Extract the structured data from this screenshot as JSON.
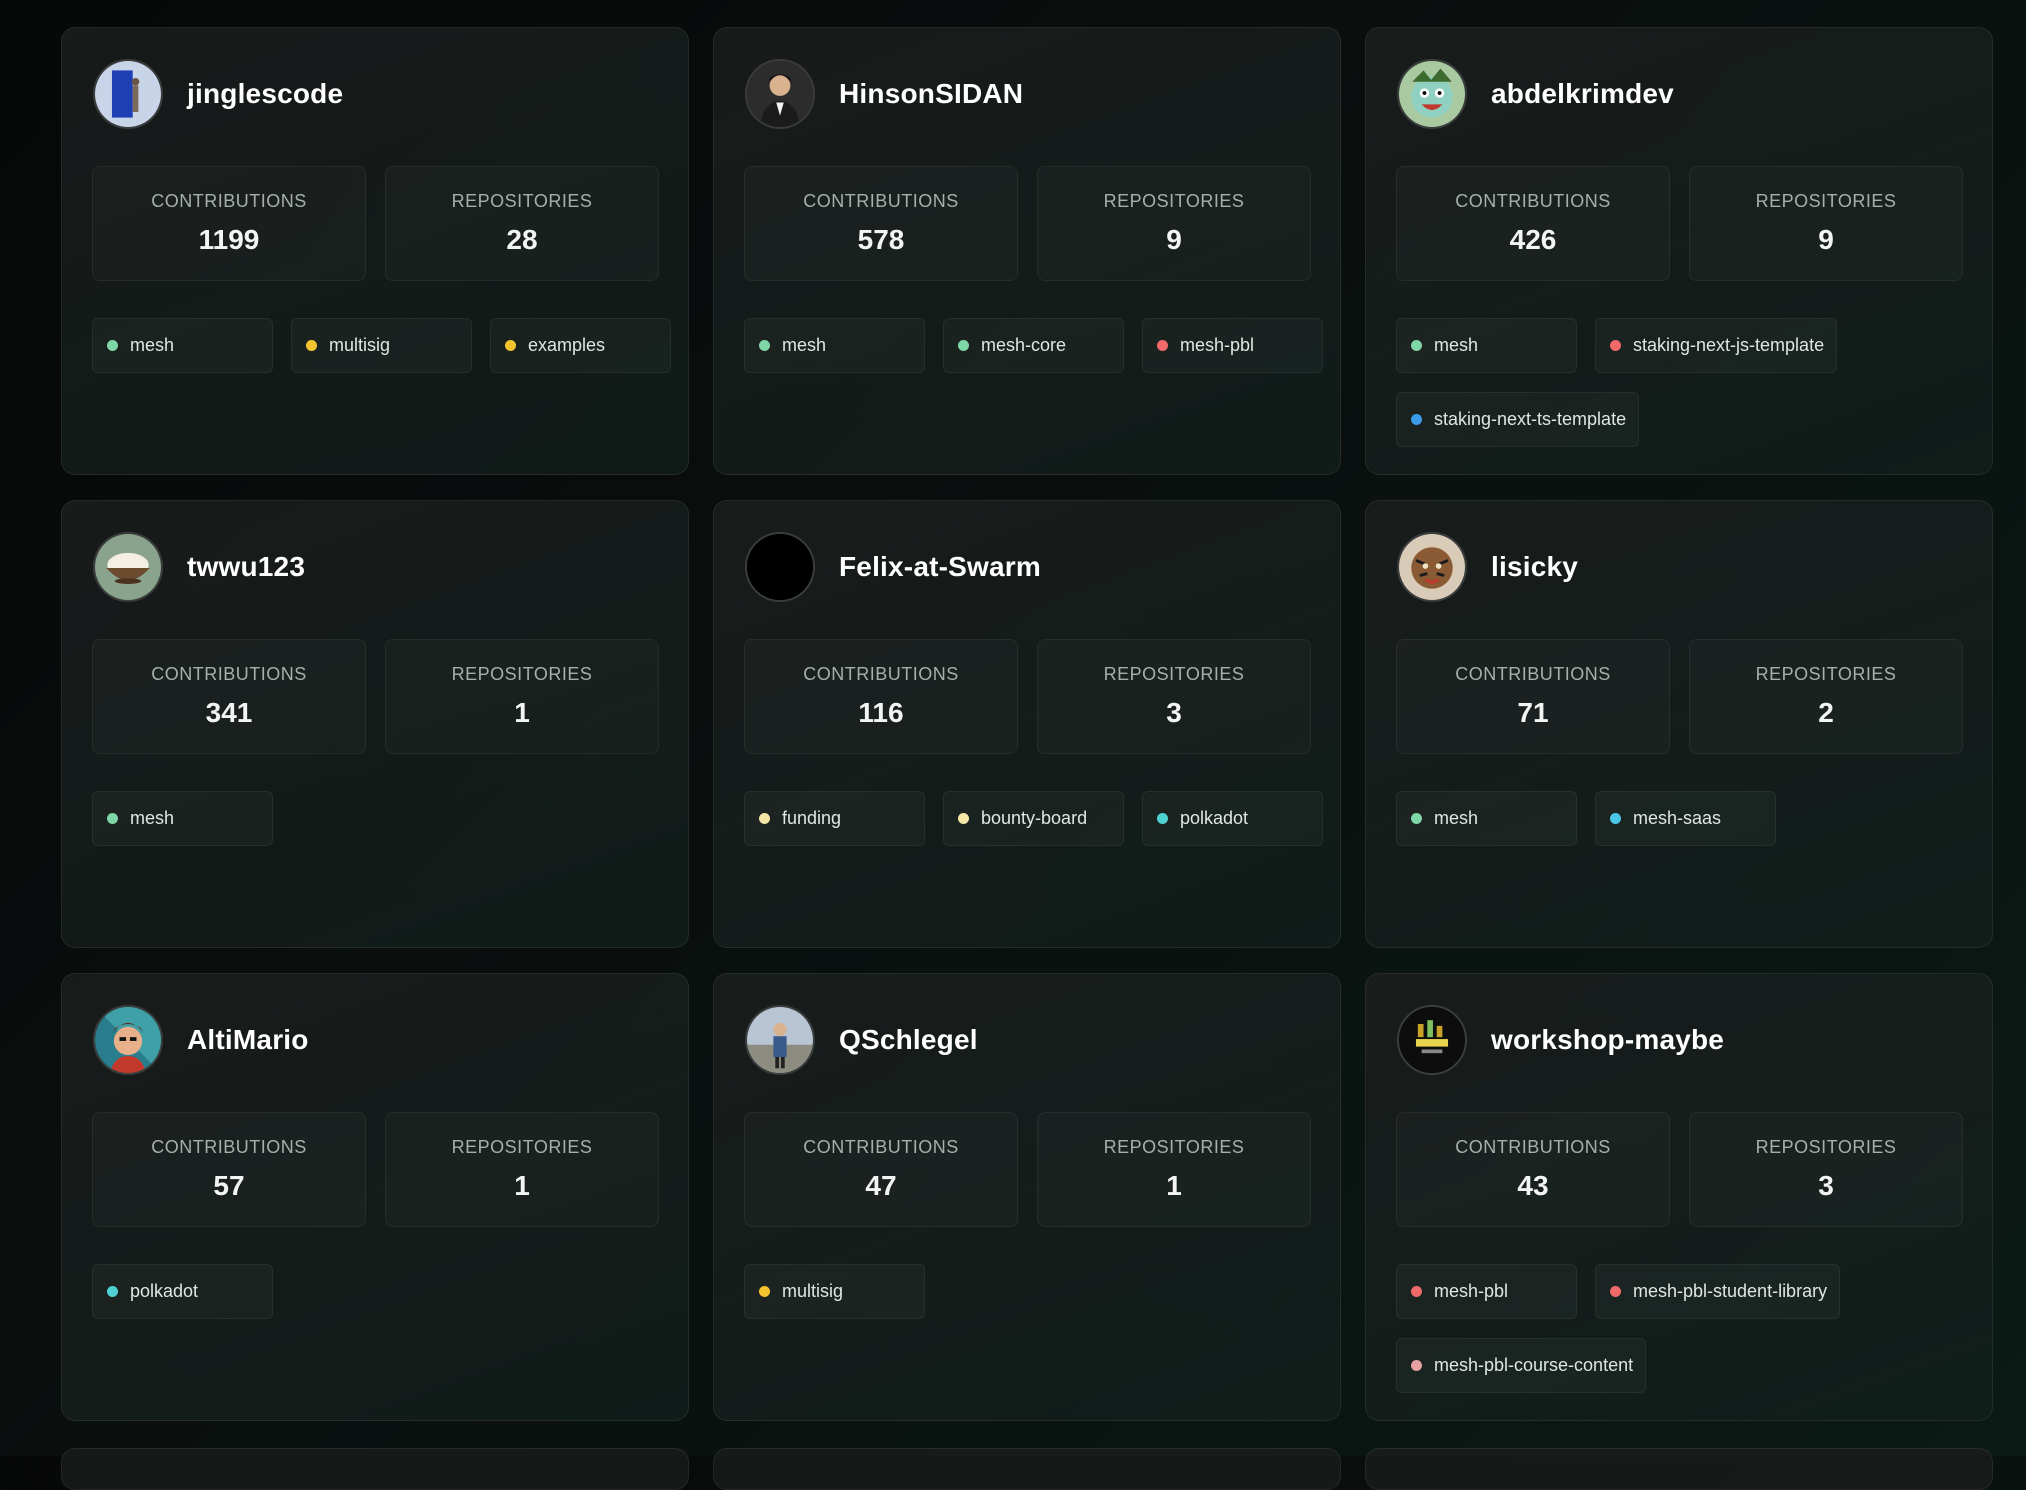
{
  "labels": {
    "contributions": "CONTRIBUTIONS",
    "repositories": "REPOSITORIES"
  },
  "colors": {
    "green": "#7fd6a6",
    "yellow": "#f4c430",
    "red": "#f06a6a",
    "blue": "#3b9be8",
    "teal": "#4fd1d1",
    "cream": "#f5e6a8",
    "cyan": "#4cc6e6",
    "pink": "#e8a0a0"
  },
  "contributors": [
    {
      "username": "jinglescode",
      "avatar": "avatar-blue-door",
      "contributions": "1199",
      "repositories": "28",
      "repos": [
        {
          "name": "mesh",
          "color": "#7fd6a6"
        },
        {
          "name": "multisig",
          "color": "#f4c430"
        },
        {
          "name": "examples",
          "color": "#f4c430"
        }
      ]
    },
    {
      "username": "HinsonSIDAN",
      "avatar": "avatar-portrait-man",
      "contributions": "578",
      "repositories": "9",
      "repos": [
        {
          "name": "mesh",
          "color": "#7fd6a6"
        },
        {
          "name": "mesh-core",
          "color": "#7fd6a6"
        },
        {
          "name": "mesh-pbl",
          "color": "#f06a6a"
        }
      ]
    },
    {
      "username": "abdelkrimdev",
      "avatar": "avatar-cartoon-face",
      "contributions": "426",
      "repositories": "9",
      "repos": [
        {
          "name": "mesh",
          "color": "#7fd6a6"
        },
        {
          "name": "staking-next-js-template",
          "color": "#f06a6a"
        },
        {
          "name": "staking-next-ts-template",
          "color": "#3b9be8"
        }
      ]
    },
    {
      "username": "twwu123",
      "avatar": "avatar-rice-bowl",
      "contributions": "341",
      "repositories": "1",
      "repos": [
        {
          "name": "mesh",
          "color": "#7fd6a6"
        }
      ]
    },
    {
      "username": "Felix-at-Swarm",
      "avatar": "avatar-black",
      "contributions": "116",
      "repositories": "3",
      "repos": [
        {
          "name": "funding",
          "color": "#f5e6a8"
        },
        {
          "name": "bounty-board",
          "color": "#f5e6a8"
        },
        {
          "name": "polkadot",
          "color": "#4fd1d1"
        }
      ]
    },
    {
      "username": "lisicky",
      "avatar": "avatar-tiger",
      "contributions": "71",
      "repositories": "2",
      "repos": [
        {
          "name": "mesh",
          "color": "#7fd6a6"
        },
        {
          "name": "mesh-saas",
          "color": "#4cc6e6"
        }
      ]
    },
    {
      "username": "AltiMario",
      "avatar": "avatar-cartoon-man",
      "contributions": "57",
      "repositories": "1",
      "repos": [
        {
          "name": "polkadot",
          "color": "#4fd1d1"
        }
      ]
    },
    {
      "username": "QSchlegel",
      "avatar": "avatar-person-outdoor",
      "contributions": "47",
      "repositories": "1",
      "repos": [
        {
          "name": "multisig",
          "color": "#f4c430"
        }
      ]
    },
    {
      "username": "workshop-maybe",
      "avatar": "avatar-workshop-logo",
      "contributions": "43",
      "repositories": "3",
      "repos": [
        {
          "name": "mesh-pbl",
          "color": "#f06a6a"
        },
        {
          "name": "mesh-pbl-student-library",
          "color": "#f06a6a"
        },
        {
          "name": "mesh-pbl-course-content",
          "color": "#e8a0a0"
        }
      ]
    }
  ]
}
